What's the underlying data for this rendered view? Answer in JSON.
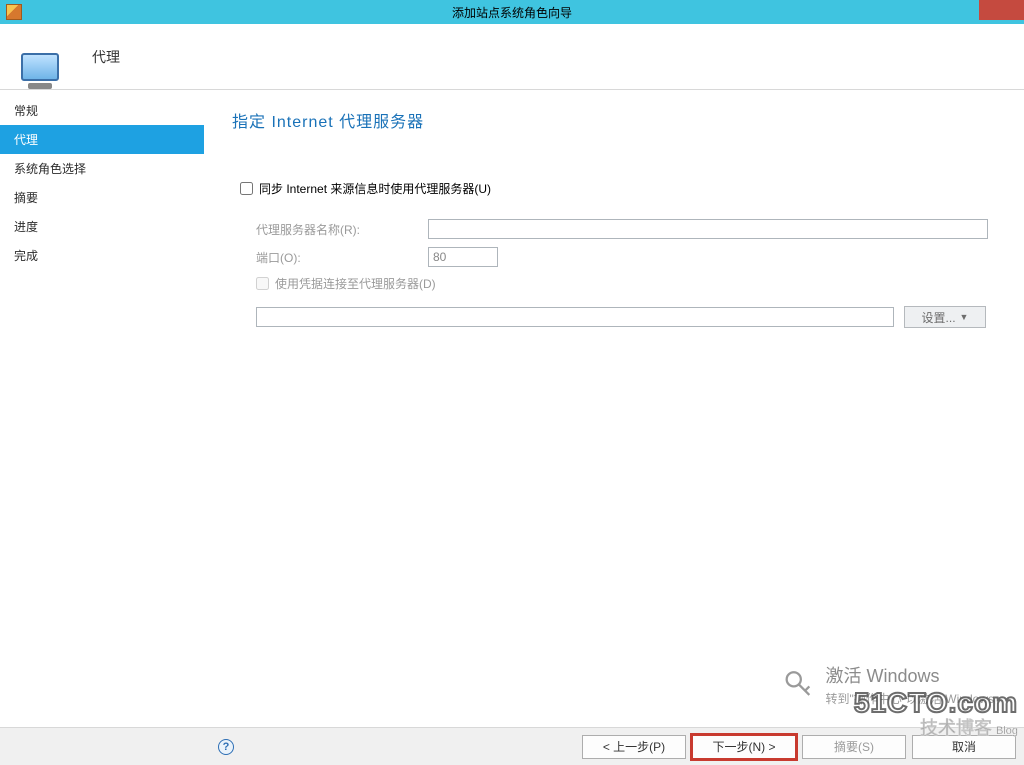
{
  "window": {
    "title": "添加站点系统角色向导"
  },
  "header": {
    "title": "代理"
  },
  "sidebar": {
    "items": [
      {
        "label": "常规",
        "selected": false
      },
      {
        "label": "代理",
        "selected": true
      },
      {
        "label": "系统角色选择",
        "selected": false
      },
      {
        "label": "摘要",
        "selected": false
      },
      {
        "label": "进度",
        "selected": false
      },
      {
        "label": "完成",
        "selected": false
      }
    ]
  },
  "content": {
    "heading": "指定 Internet 代理服务器",
    "use_proxy_checkbox_label": "同步 Internet 来源信息时使用代理服务器(U)",
    "proxy_name_label": "代理服务器名称(R):",
    "proxy_name_value": "",
    "port_label": "端口(O):",
    "port_value": "80",
    "use_credentials_label": "使用凭据连接至代理服务器(D)",
    "credentials_value": "",
    "settings_button": "设置..."
  },
  "activation": {
    "line1": "激活 Windows",
    "line2": "转到\"操作中心\"以激活 Windows。"
  },
  "footer": {
    "previous": "< 上一步(P)",
    "next": "下一步(N) >",
    "summary": "摘要(S)",
    "cancel": "取消"
  },
  "watermark": {
    "line1": "51CTO.com",
    "line2": "技术博客",
    "blog": "Blog"
  }
}
